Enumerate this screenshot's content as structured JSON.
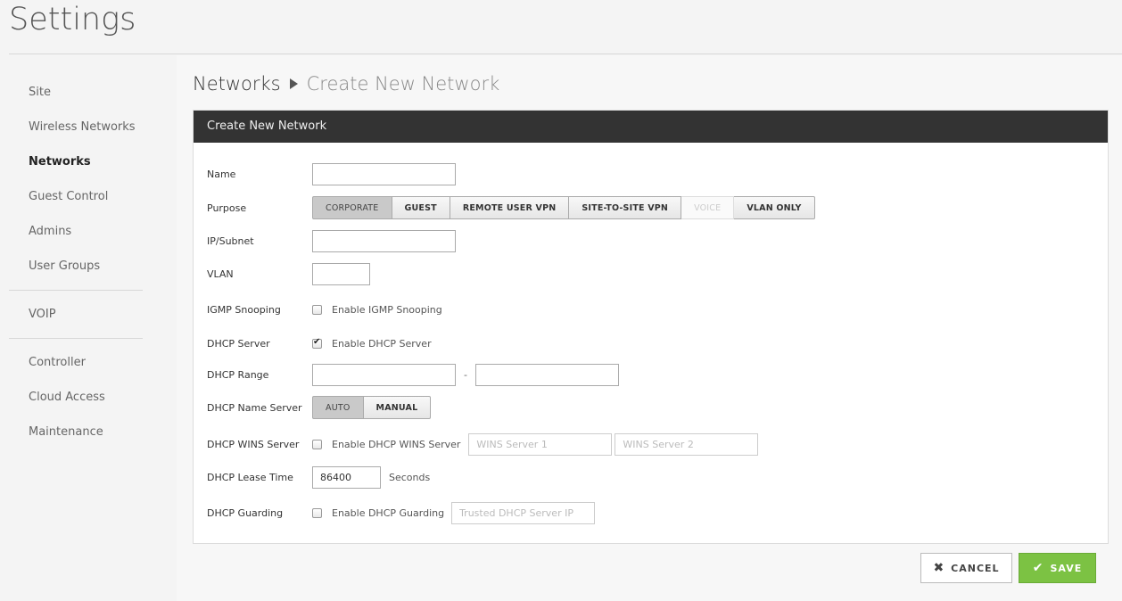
{
  "page": {
    "title": "Settings"
  },
  "sidebar": {
    "groups": [
      [
        "Site",
        "Wireless Networks",
        "Networks",
        "Guest Control",
        "Admins",
        "User Groups"
      ],
      [
        "VOIP"
      ],
      [
        "Controller",
        "Cloud Access",
        "Maintenance"
      ]
    ],
    "active": "Networks"
  },
  "breadcrumb": {
    "parent": "Networks",
    "current": "Create New Network"
  },
  "panel": {
    "title": "Create New Network"
  },
  "form": {
    "name": {
      "label": "Name",
      "value": ""
    },
    "purpose": {
      "label": "Purpose",
      "options": [
        "CORPORATE",
        "GUEST",
        "REMOTE USER VPN",
        "SITE-TO-SITE VPN",
        "VOICE",
        "VLAN ONLY"
      ],
      "selected": "CORPORATE",
      "disabled": [
        "VOICE"
      ]
    },
    "ip_subnet": {
      "label": "IP/Subnet",
      "value": ""
    },
    "vlan": {
      "label": "VLAN",
      "value": ""
    },
    "igmp": {
      "label": "IGMP Snooping",
      "checkbox_label": "Enable IGMP Snooping",
      "checked": false
    },
    "dhcp_server": {
      "label": "DHCP Server",
      "checkbox_label": "Enable DHCP Server",
      "checked": true
    },
    "dhcp_range": {
      "label": "DHCP Range",
      "start": "",
      "end": "",
      "separator": "-"
    },
    "dhcp_name_server": {
      "label": "DHCP Name Server",
      "options": [
        "AUTO",
        "MANUAL"
      ],
      "selected": "AUTO"
    },
    "dhcp_wins": {
      "label": "DHCP WINS Server",
      "checkbox_label": "Enable DHCP WINS Server",
      "checked": false,
      "placeholder1": "WINS Server 1",
      "placeholder2": "WINS Server 2"
    },
    "lease_time": {
      "label": "DHCP Lease Time",
      "value": "86400",
      "unit": "Seconds"
    },
    "guarding": {
      "label": "DHCP Guarding",
      "checkbox_label": "Enable DHCP Guarding",
      "checked": false,
      "placeholder": "Trusted DHCP Server IP"
    }
  },
  "actions": {
    "cancel": "CANCEL",
    "save": "SAVE"
  },
  "colors": {
    "header_bg": "#333333",
    "save_bg": "#7cc243"
  }
}
